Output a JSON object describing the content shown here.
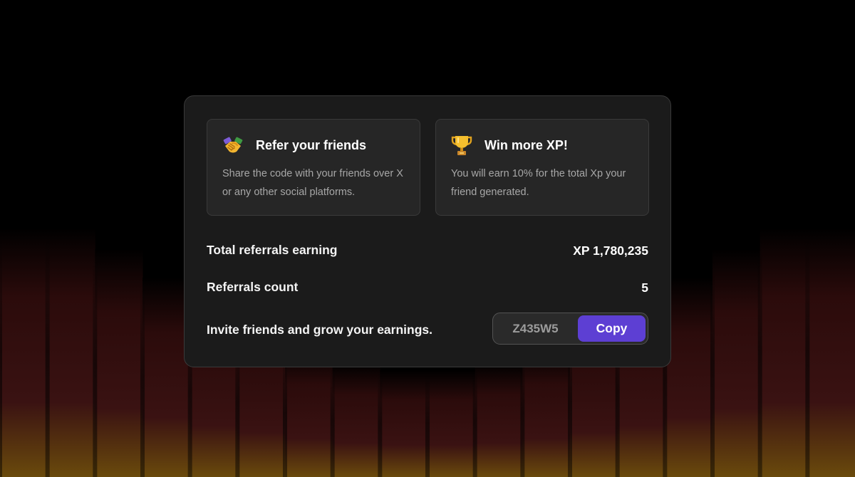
{
  "colors": {
    "accent": "#5d3fd3",
    "panel": "#1b1b1b",
    "card": "#262626",
    "bar_top": "#2b0b0b",
    "bar_mid": "#3a1212",
    "bar_bottom": "#6a4a0c"
  },
  "cards": [
    {
      "icon": "handshake-icon",
      "title": "Refer your friends",
      "description": "Share the code with your friends over X or any other social platforms."
    },
    {
      "icon": "trophy-icon",
      "title": "Win more XP!",
      "description": "You will earn 10% for the total Xp your friend generated."
    }
  ],
  "stats": {
    "total_label": "Total referrals earning",
    "total_value": "XP 1,780,235",
    "count_label": "Referrals count",
    "count_value": "5"
  },
  "invite": {
    "label": "Invite friends and grow your earnings.",
    "code": "Z435W5",
    "copy_label": "Copy"
  }
}
